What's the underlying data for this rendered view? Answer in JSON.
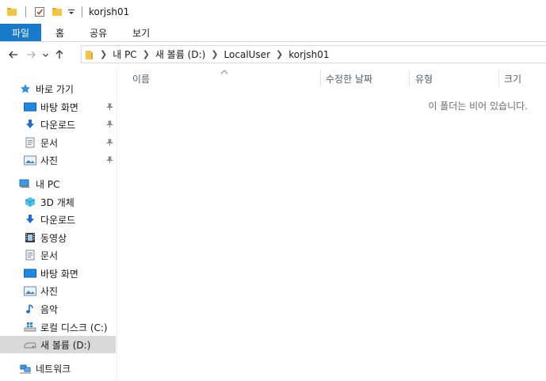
{
  "window": {
    "title": "korjsh01"
  },
  "ribbon": {
    "tabs": [
      {
        "label": "파일"
      },
      {
        "label": "홈"
      },
      {
        "label": "공유"
      },
      {
        "label": "보기"
      }
    ]
  },
  "address": {
    "crumbs": [
      "내 PC",
      "새 볼륨 (D:)",
      "LocalUser",
      "korjsh01"
    ]
  },
  "sidebar": {
    "quick_access": {
      "label": "바로 가기",
      "items": [
        {
          "label": "바탕 화면",
          "icon": "desktop-icon",
          "pinned": true
        },
        {
          "label": "다운로드",
          "icon": "download-icon",
          "pinned": true
        },
        {
          "label": "문서",
          "icon": "document-icon",
          "pinned": true
        },
        {
          "label": "사진",
          "icon": "pictures-icon",
          "pinned": true
        }
      ]
    },
    "this_pc": {
      "label": "내 PC",
      "items": [
        {
          "label": "3D 개체",
          "icon": "3d-objects-icon"
        },
        {
          "label": "다운로드",
          "icon": "download-icon"
        },
        {
          "label": "동영상",
          "icon": "videos-icon"
        },
        {
          "label": "문서",
          "icon": "document-icon"
        },
        {
          "label": "바탕 화면",
          "icon": "desktop-icon"
        },
        {
          "label": "사진",
          "icon": "pictures-icon"
        },
        {
          "label": "음악",
          "icon": "music-icon"
        },
        {
          "label": "로컬 디스크 (C:)",
          "icon": "local-disk-icon"
        },
        {
          "label": "새 볼륨 (D:)",
          "icon": "drive-icon",
          "selected": true
        }
      ]
    },
    "network": {
      "label": "네트워크"
    }
  },
  "columns": {
    "name": "이름",
    "modified": "수정한 날짜",
    "type": "유형",
    "size": "크기"
  },
  "content": {
    "empty_message": "이 폴더는 비어 있습니다."
  },
  "colors": {
    "accent": "#1979ca",
    "selection": "#d9d9d9",
    "header_text": "#4c607a"
  }
}
